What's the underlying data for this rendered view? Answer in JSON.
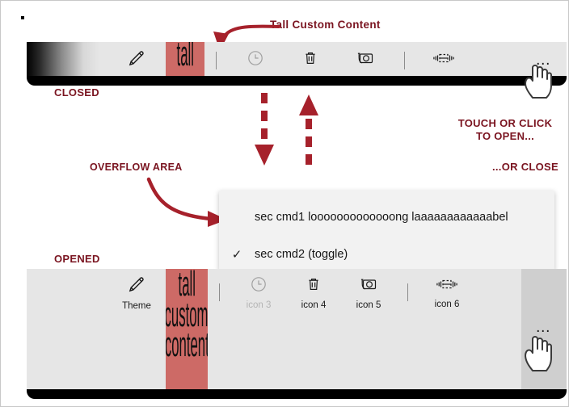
{
  "annotations": {
    "tall_custom_content": "Tall Custom Content",
    "closed": "CLOSED",
    "opened": "OPENED",
    "overflow_area": "OVERFLOW AREA",
    "touch_or_click_to_open": "TOUCH OR CLICK\nTO OPEN...",
    "or_close": "...OR CLOSE"
  },
  "colors": {
    "annotation_red": "#7a1420",
    "arrow_red": "#a6212b",
    "tall_block_bg": "#cd6a66",
    "toolbar_bg": "#e6e6e6",
    "flyout_bg": "#f2f2f2",
    "overflow_hover_bg": "#cfcfcf"
  },
  "closed_toolbar": {
    "name": "CLOSED",
    "items": [
      {
        "icon": "pencil-icon",
        "label": "",
        "disabled": false
      },
      {
        "icon": "tall-custom-content",
        "label": "",
        "disabled": false
      },
      {
        "icon": "separator",
        "label": "",
        "disabled": false
      },
      {
        "icon": "clock-icon",
        "label": "",
        "disabled": true
      },
      {
        "icon": "trash-icon",
        "label": "",
        "disabled": false
      },
      {
        "icon": "camera-icon",
        "label": "",
        "disabled": false
      },
      {
        "icon": "separator",
        "label": "",
        "disabled": false
      },
      {
        "icon": "resize-width-icon",
        "label": "",
        "disabled": false
      }
    ],
    "overflow_label": "…"
  },
  "opened_toolbar": {
    "name": "OPENED",
    "items": [
      {
        "icon": "pencil-icon",
        "label": "Theme",
        "disabled": false
      },
      {
        "icon": "tall-custom-content",
        "label": "",
        "disabled": false
      },
      {
        "icon": "separator",
        "label": "",
        "disabled": false
      },
      {
        "icon": "clock-icon",
        "label": "icon 3",
        "disabled": true
      },
      {
        "icon": "trash-icon",
        "label": "icon 4",
        "disabled": false
      },
      {
        "icon": "camera-icon",
        "label": "icon 5",
        "disabled": false
      },
      {
        "icon": "separator",
        "label": "",
        "disabled": false
      },
      {
        "icon": "resize-width-icon",
        "label": "icon 6",
        "disabled": false
      }
    ],
    "overflow_label": "…"
  },
  "tall_block": {
    "line1": "tall",
    "line2": "custom",
    "line3": "content"
  },
  "overflow_flyout": {
    "items": [
      {
        "check": "",
        "label": "sec cmd1 looooooooooooong laaaaaaaaaaaabel",
        "checked": false
      },
      {
        "check": "✓",
        "label": "sec cmd2 (toggle)",
        "checked": true
      }
    ]
  }
}
